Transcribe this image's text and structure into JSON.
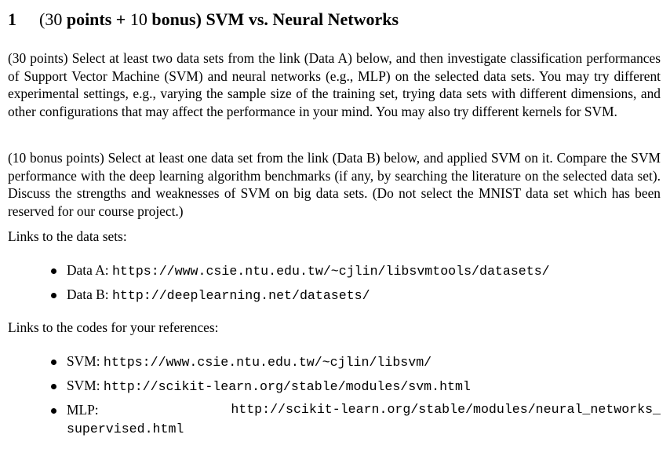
{
  "heading": {
    "number": "1",
    "open_paren": "(",
    "points_num": "30",
    "points_word": " points + ",
    "bonus_num": "10",
    "bonus_word": " bonus)",
    "rest": " SVM vs. Neural Networks"
  },
  "paragraphs": [
    "(30 points) Select at least two data sets from the link (Data A) below, and then investigate classification performances of Support Vector Machine (SVM) and neural networks (e.g., MLP) on the selected data sets. You may try different experimental settings, e.g., varying the sample size of the training set, trying data sets with different dimensions, and other configurations that may affect the performance in your mind. You may also try different kernels for SVM.",
    "(10 bonus points) Select at least one data set from the link (Data B) below, and applied SVM on it. Compare the SVM performance with the deep learning algorithm benchmarks (if any, by searching the literature on the selected data set). Discuss the strengths and weaknesses of SVM on big data sets. (Do not select the MNIST data set which has been reserved for our course project.)"
  ],
  "datasets_label": "Links to the data sets:",
  "datasets": [
    {
      "label": "Data A: ",
      "url": "https://www.csie.ntu.edu.tw/~cjlin/libsvmtools/datasets/"
    },
    {
      "label": "Data B: ",
      "url": "http://deeplearning.net/datasets/"
    }
  ],
  "codes_label": "Links to the codes for your references:",
  "codes": [
    {
      "label": "SVM: ",
      "url": "https://www.csie.ntu.edu.tw/~cjlin/libsvm/"
    },
    {
      "label": "SVM: ",
      "url": "http://scikit-learn.org/stable/modules/svm.html"
    }
  ],
  "mlp": {
    "label": "MLP:",
    "url_part1": "http://scikit-learn.org/stable/modules/neural_networks_",
    "url_part2": "supervised.html"
  }
}
